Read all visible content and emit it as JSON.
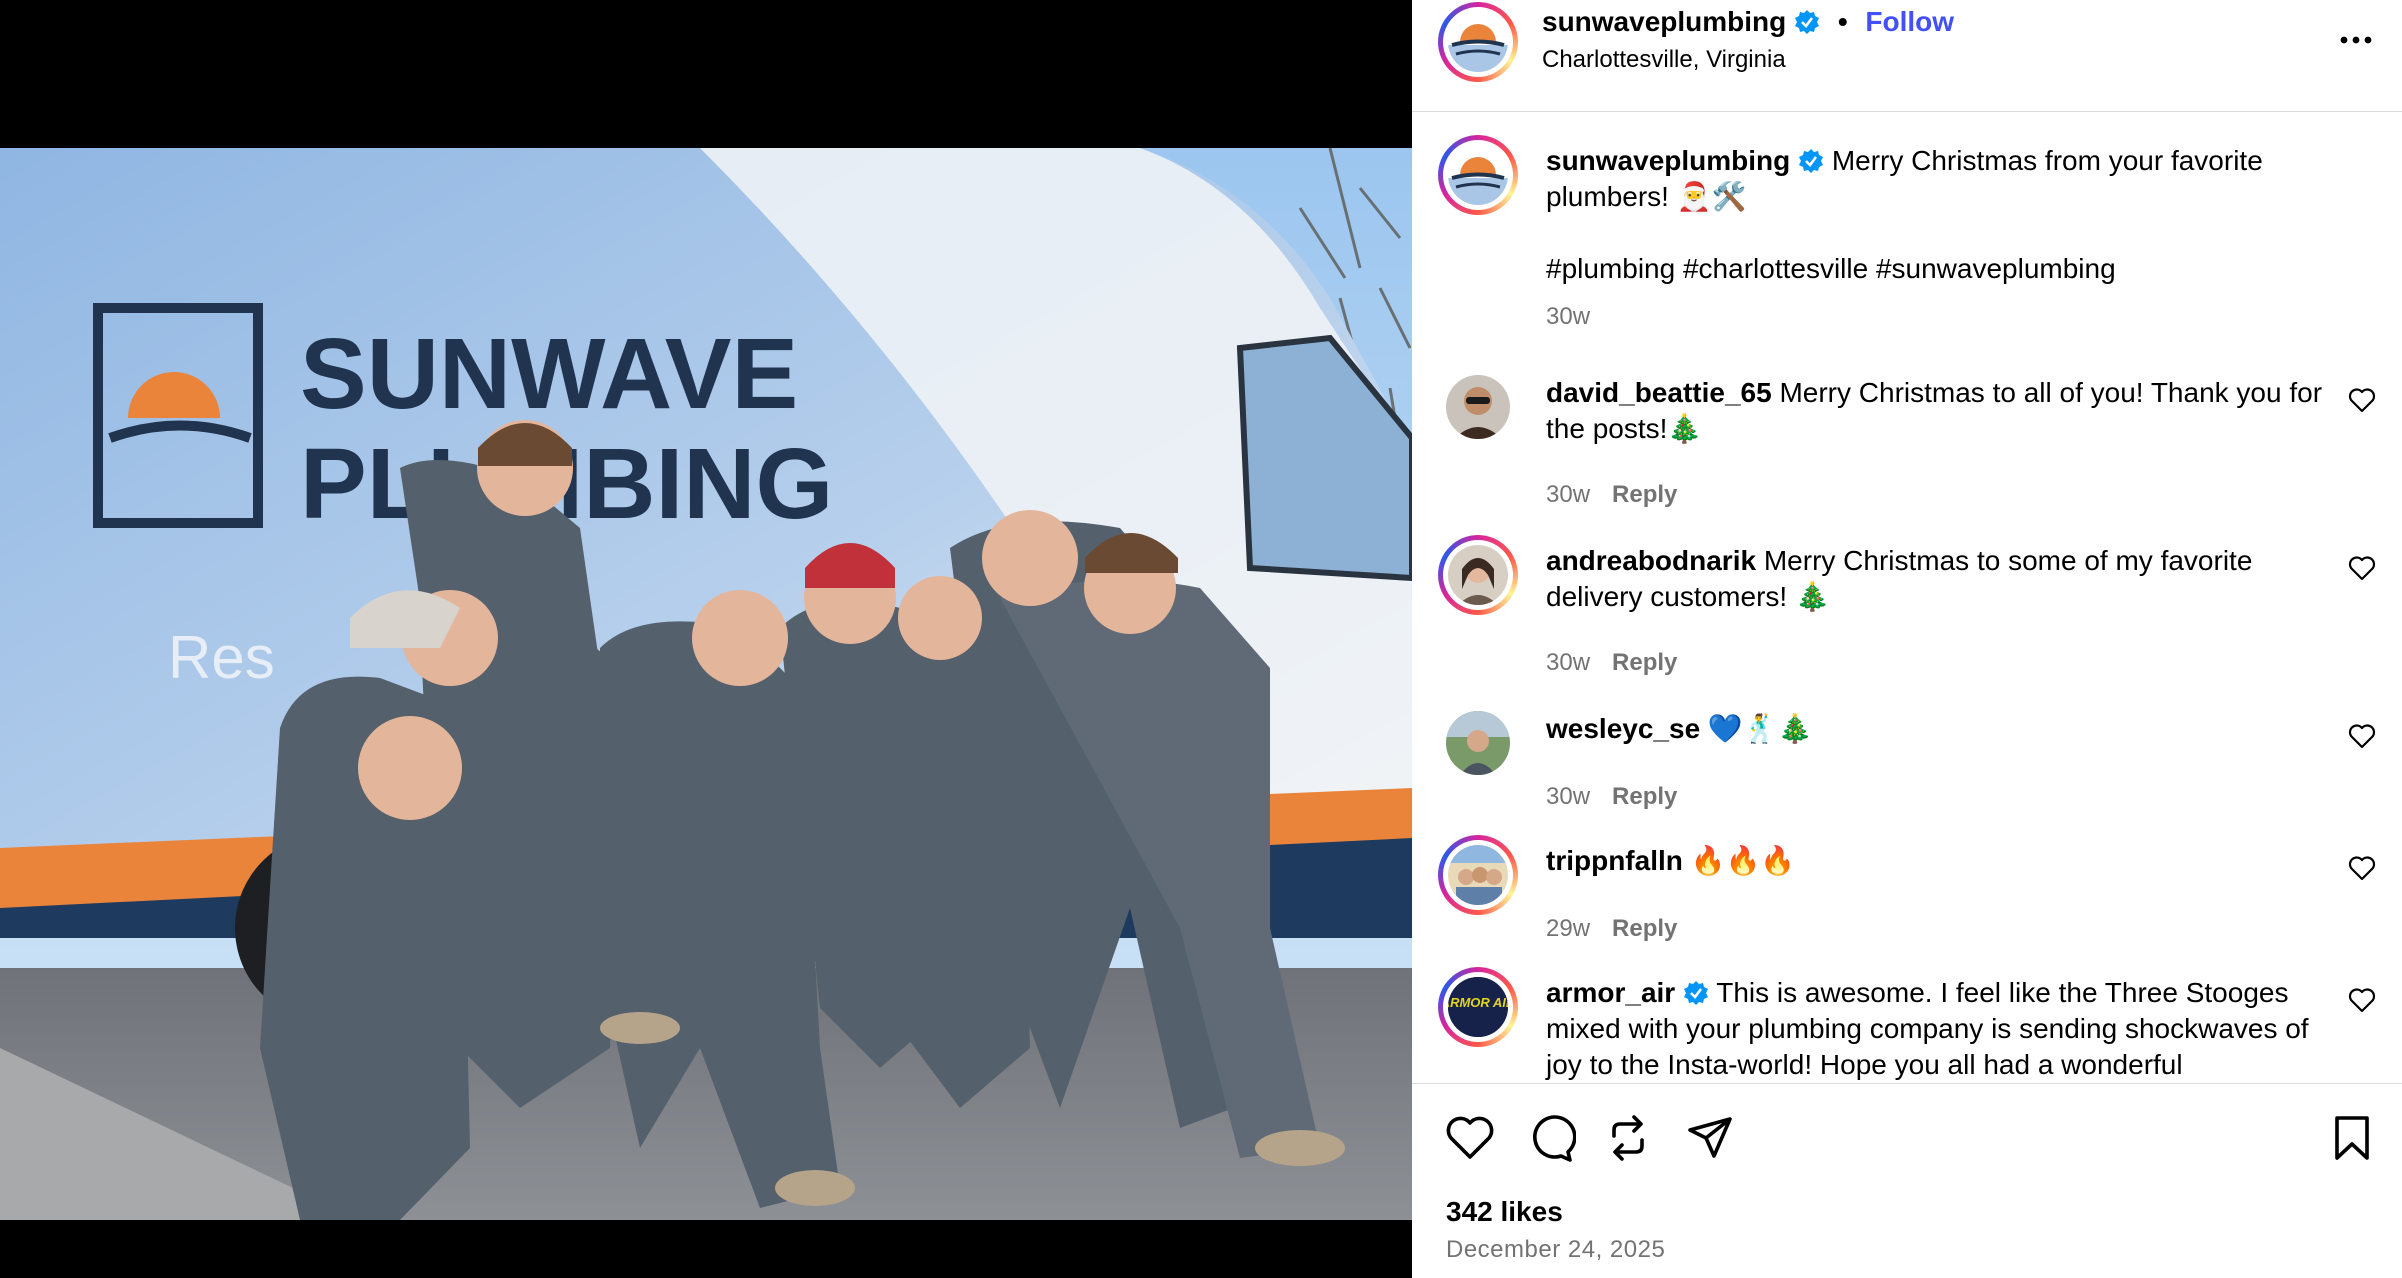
{
  "post": {
    "author": "sunwaveplumbing",
    "location": "Charlottesville, Virginia",
    "follow_label": "Follow",
    "dot": "•",
    "caption": "Merry Christmas from your favorite plumbers! 🎅🛠️",
    "hashtags": "#plumbing #charlottesville #sunwaveplumbing",
    "age": "30w"
  },
  "photo_text": {
    "van_brand_line1": "SUNWAVE",
    "van_brand_line2": "PLUMBING",
    "van_tagline": "Res"
  },
  "comments": [
    {
      "user": "david_beattie_65",
      "text": "Merry Christmas to all of you! Thank you for the posts!🎄",
      "age": "30w",
      "reply": "Reply"
    },
    {
      "user": "andreabodnarik",
      "text": "Merry Christmas to some of my favorite delivery customers! 🎄",
      "age": "30w",
      "reply": "Reply"
    },
    {
      "user": "wesleyc_se",
      "text": "💙🕺🎄",
      "age": "30w",
      "reply": "Reply"
    },
    {
      "user": "trippnfalln",
      "text": "🔥🔥🔥",
      "age": "29w",
      "reply": "Reply"
    },
    {
      "user": "armor_air",
      "text": "This is awesome. I feel like the Three Stooges mixed with your plumbing company is sending shockwaves of joy to the Insta-world! Hope you all had a wonderful",
      "age": "",
      "reply": "",
      "avatar_text": "ARMOR AIR"
    }
  ],
  "footer": {
    "likes": "342 likes",
    "date": "December 24, 2025"
  },
  "colors": {
    "link": "#4150f7",
    "muted": "#737373",
    "verified": "#0095f6",
    "divider": "#dbdbdb"
  },
  "icons": [
    "verified-icon",
    "more-icon",
    "heart-icon",
    "comment-icon",
    "repost-icon",
    "share-icon",
    "bookmark-icon"
  ]
}
